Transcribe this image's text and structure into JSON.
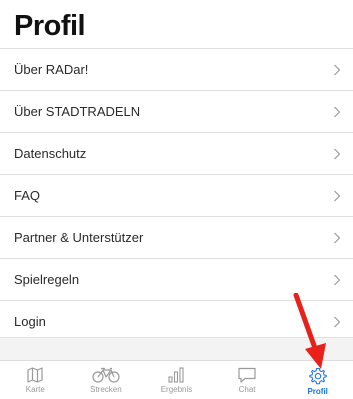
{
  "header": {
    "title": "Profil"
  },
  "menu": {
    "items": [
      {
        "label": "Über RADar!"
      },
      {
        "label": "Über STADTRADELN"
      },
      {
        "label": "Datenschutz"
      },
      {
        "label": "FAQ"
      },
      {
        "label": "Partner & Unterstützer"
      },
      {
        "label": "Spielregeln"
      },
      {
        "label": "Login"
      }
    ]
  },
  "tabbar": {
    "tabs": [
      {
        "label": "Karte",
        "icon": "map-icon",
        "active": false
      },
      {
        "label": "Strecken",
        "icon": "bicycle-icon",
        "active": false
      },
      {
        "label": "Ergebnis",
        "icon": "bar-chart-icon",
        "active": false
      },
      {
        "label": "Chat",
        "icon": "chat-icon",
        "active": false
      },
      {
        "label": "Profil",
        "icon": "gear-icon",
        "active": true
      }
    ]
  },
  "colors": {
    "accent": "#1a73e8",
    "inactive": "#9a9a9a",
    "annotation_arrow": "#e8211a"
  }
}
